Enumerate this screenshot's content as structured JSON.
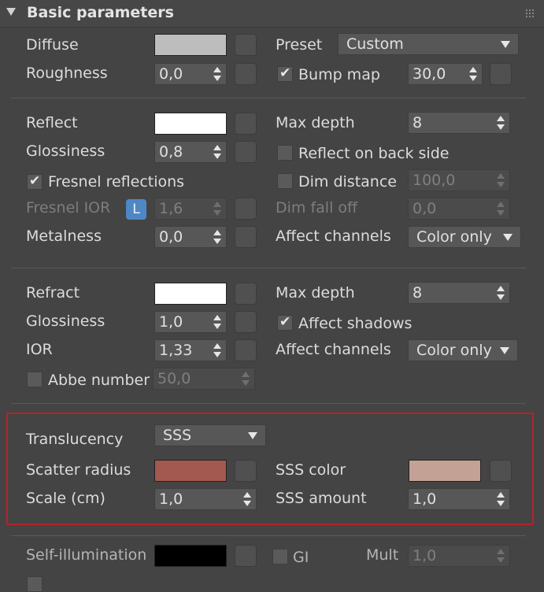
{
  "panel": {
    "title": "Basic parameters"
  },
  "colors": {
    "diffuse": "#bdbdbd",
    "reflect": "#ffffff",
    "refract": "#ffffff",
    "scatter_radius": "#a3594f",
    "sss_color": "#c4a195",
    "self_illumination": "#000000",
    "highlight_border": "#b3232c"
  },
  "diffuse": {
    "label": "Diffuse"
  },
  "roughness": {
    "label": "Roughness",
    "value": "0,0"
  },
  "preset": {
    "label": "Preset",
    "value": "Custom"
  },
  "bump_map": {
    "label": "Bump map",
    "checked": true,
    "value": "30,0"
  },
  "reflect": {
    "label": "Reflect",
    "glossiness_label": "Glossiness",
    "glossiness": "0,8",
    "fresnel_label": "Fresnel reflections",
    "fresnel_checked": true,
    "fresnel_ior_label": "Fresnel IOR",
    "lock_label": "L",
    "fresnel_ior": "1,6",
    "metalness_label": "Metalness",
    "metalness": "0,0",
    "max_depth_label": "Max depth",
    "max_depth": "8",
    "back_side_label": "Reflect on back side",
    "dim_distance_label": "Dim distance",
    "dim_distance": "100,0",
    "dim_fall_off_label": "Dim fall off",
    "dim_fall_off": "0,0",
    "affect_channels_label": "Affect channels",
    "affect_channels": "Color only"
  },
  "refract": {
    "label": "Refract",
    "glossiness_label": "Glossiness",
    "glossiness": "1,0",
    "ior_label": "IOR",
    "ior": "1,33",
    "abbe_label": "Abbe number",
    "abbe": "50,0",
    "max_depth_label": "Max depth",
    "max_depth": "8",
    "affect_shadows_label": "Affect shadows",
    "affect_shadows_checked": true,
    "affect_channels_label": "Affect channels",
    "affect_channels": "Color only"
  },
  "translucency": {
    "label": "Translucency",
    "value": "SSS",
    "scatter_radius_label": "Scatter radius",
    "scale_label": "Scale (cm)",
    "scale": "1,0",
    "sss_color_label": "SSS color",
    "sss_amount_label": "SSS amount",
    "sss_amount": "1,0"
  },
  "self_illumination": {
    "label": "Self-illumination",
    "gi_label": "GI",
    "mult_label": "Mult",
    "mult": "1,0"
  }
}
